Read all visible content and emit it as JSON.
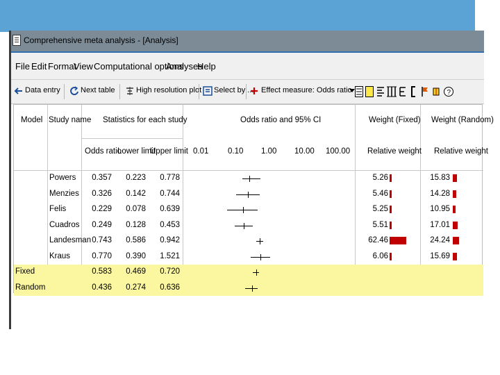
{
  "window": {
    "title": "Comprehensive meta analysis - [Analysis]"
  },
  "menu": [
    "File",
    "Edit",
    "Format",
    "View",
    "Computational options",
    "Analyses",
    "Help"
  ],
  "toolbar": {
    "data_entry": "Data entry",
    "next_table": "Next table",
    "high_resolution": "High resolution plot",
    "select_by": "Select by ...",
    "effect_measure": "Effect measure: Odds ratio"
  },
  "headers": {
    "model": "Model",
    "study_name": "Study name",
    "stats_group": "Statistics for each study",
    "odds_ratio": "Odds ratio",
    "lower_limit": "Lower limit",
    "upper_limit": "Upper limit",
    "plot_title": "Odds ratio and 95% CI",
    "plot_ticks": [
      "0.01",
      "0.10",
      "1.00",
      "10.00",
      "100.00"
    ],
    "weight_fixed": "Weight (Fixed)",
    "weight_random": "Weight (Random)",
    "relative_weight": "Relative weight"
  },
  "rows": [
    {
      "model": "",
      "study": "Powers",
      "or": "0.357",
      "lower": "0.223",
      "upper": "0.778",
      "wf": "5.26",
      "wr": "15.83",
      "wf_val": 5.26,
      "wr_val": 15.83
    },
    {
      "model": "",
      "study": "Menzies",
      "or": "0.326",
      "lower": "0.142",
      "upper": "0.744",
      "wf": "5.46",
      "wr": "14.28",
      "wf_val": 5.46,
      "wr_val": 14.28
    },
    {
      "model": "",
      "study": "Felis",
      "or": "0.229",
      "lower": "0.078",
      "upper": "0.639",
      "wf": "5.25",
      "wr": "10.95",
      "wf_val": 5.25,
      "wr_val": 10.95
    },
    {
      "model": "",
      "study": "Cuadros",
      "or": "0.249",
      "lower": "0.128",
      "upper": "0.453",
      "wf": "5.51",
      "wr": "17.01",
      "wf_val": 5.51,
      "wr_val": 17.01
    },
    {
      "model": "",
      "study": "Landesman",
      "or": "0.743",
      "lower": "0.586",
      "upper": "0.942",
      "wf": "62.46",
      "wr": "24.24",
      "wf_val": 62.46,
      "wr_val": 24.24
    },
    {
      "model": "",
      "study": "Kraus",
      "or": "0.770",
      "lower": "0.390",
      "upper": "1.521",
      "wf": "6.06",
      "wr": "15.69",
      "wf_val": 6.06,
      "wr_val": 15.69
    },
    {
      "model": "Fixed",
      "study": "",
      "or": "0.583",
      "lower": "0.469",
      "upper": "0.720",
      "wf": "",
      "wr": "",
      "summary": true
    },
    {
      "model": "Random",
      "study": "",
      "or": "0.436",
      "lower": "0.274",
      "upper": "0.636",
      "wf": "",
      "wr": "",
      "summary": true
    }
  ],
  "colors": {
    "accent_band": "#5aa3d4",
    "weight_bar": "#c00000",
    "summary_highlight": "#fbf7a0"
  }
}
